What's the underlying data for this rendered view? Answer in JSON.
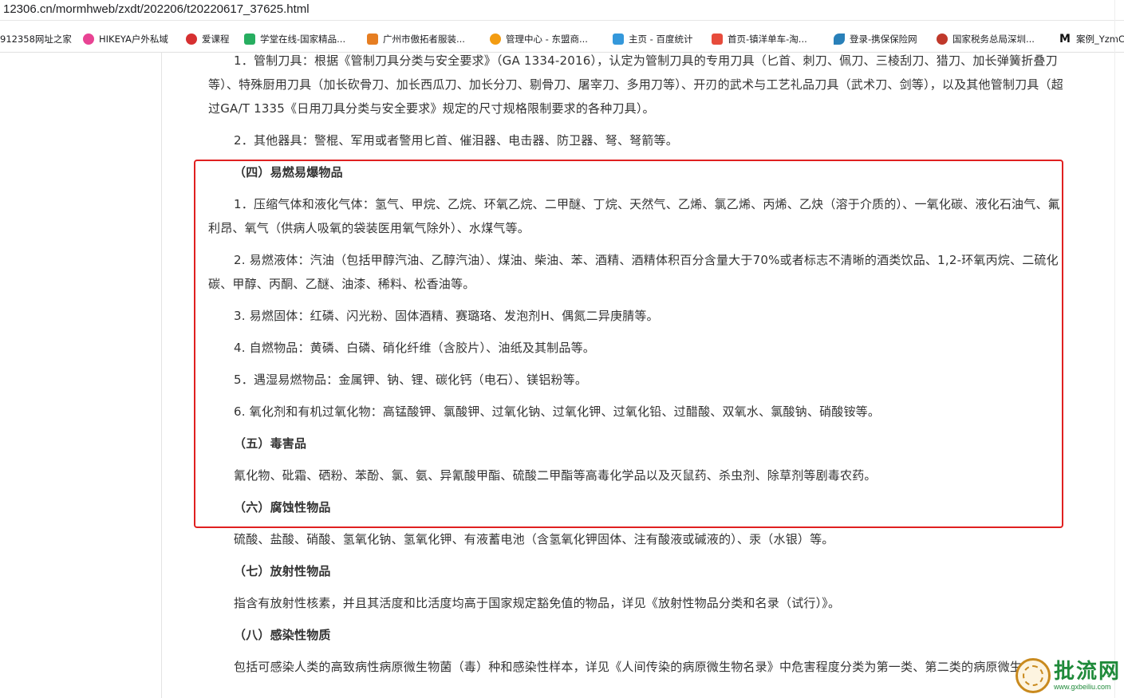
{
  "browser": {
    "url": "12306.cn/mormhweb/zxdt/202206/t20220617_37625.html",
    "bookmarks": [
      {
        "label": "912358网址之家",
        "icon": "site-icon",
        "color": ""
      },
      {
        "label": "HIKEYA户外私域",
        "icon": "hikeya-icon",
        "color": "#e84393"
      },
      {
        "label": "爱课程",
        "icon": "course-icon",
        "color": "#d63031"
      },
      {
        "label": "学堂在线-国家精品...",
        "icon": "xuetang-icon",
        "color": "#27ae60"
      },
      {
        "label": "广州市傲拓者服装...",
        "icon": "alibaba-icon",
        "color": "#e67e22"
      },
      {
        "label": "管理中心 - 东盟商...",
        "icon": "asean-icon",
        "color": "#f39c12"
      },
      {
        "label": "主页 - 百度统计",
        "icon": "baidu-stats-icon",
        "color": "#3498db"
      },
      {
        "label": "首页-镇洋单车-淘...",
        "icon": "taobao-icon",
        "color": "#e74c3c"
      },
      {
        "label": "登录-携保保险网",
        "icon": "bird-icon",
        "color": "#2980b9"
      },
      {
        "label": "国家税务总局深圳...",
        "icon": "tax-icon",
        "color": "#c0392b"
      },
      {
        "label": "案例_YzmC",
        "icon": "m-icon",
        "color": "#111111"
      }
    ]
  },
  "content": {
    "p1": "1．管制刀具：根据《管制刀具分类与安全要求》（GA 1334-2016），认定为管制刀具的专用刀具（匕首、刺刀、佩刀、三棱刮刀、猎刀、加长弹簧折叠刀等）、特殊厨用刀具（加长砍骨刀、加长西瓜刀、加长分刀、剔骨刀、屠宰刀、多用刀等）、开刃的武术与工艺礼品刀具（武术刀、剑等），以及其他管制刀具（超过GA/T 1335《日用刀具分类与安全要求》规定的尺寸规格限制要求的各种刀具）。",
    "p2": "2．其他器具：警棍、军用或者警用匕首、催泪器、电击器、防卫器、弩、弩箭等。",
    "h4": "（四）易燃易爆物品",
    "p4_1": "1．压缩气体和液化气体：氢气、甲烷、乙烷、环氧乙烷、二甲醚、丁烷、天然气、乙烯、氯乙烯、丙烯、乙炔（溶于介质的）、一氧化碳、液化石油气、氟利昂、氧气（供病人吸氧的袋装医用氧气除外）、水煤气等。",
    "p4_2": "2. 易燃液体：汽油（包括甲醇汽油、乙醇汽油）、煤油、柴油、苯、酒精、酒精体积百分含量大于70%或者标志不清晰的酒类饮品、1,2-环氧丙烷、二硫化碳、甲醇、丙酮、乙醚、油漆、稀料、松香油等。",
    "p4_3": "3. 易燃固体：红磷、闪光粉、固体酒精、赛璐珞、发泡剂H、偶氮二异庚腈等。",
    "p4_4": "4. 自燃物品：黄磷、白磷、硝化纤维（含胶片）、油纸及其制品等。",
    "p4_5": "5．遇湿易燃物品：金属钾、钠、锂、碳化钙（电石）、镁铝粉等。",
    "p4_6": "6. 氧化剂和有机过氧化物：高锰酸钾、氯酸钾、过氧化钠、过氧化钾、过氧化铅、过醋酸、双氧水、氯酸钠、硝酸铵等。",
    "h5": "（五）毒害品",
    "p5": "氰化物、砒霜、硒粉、苯酚、氯、氨、异氰酸甲酯、硫酸二甲酯等高毒化学品以及灭鼠药、杀虫剂、除草剂等剧毒农药。",
    "h6": "（六）腐蚀性物品",
    "p6": "硫酸、盐酸、硝酸、氢氧化钠、氢氧化钾、有液蓄电池（含氢氧化钾固体、注有酸液或碱液的）、汞（水银）等。",
    "h7": "（七）放射性物品",
    "p7": "指含有放射性核素，并且其活度和比活度均高于国家规定豁免值的物品，详见《放射性物品分类和名录（试行）》。",
    "h8": "（八）感染性物质",
    "p8": "包括可感染人类的高致病性病原微生物菌（毒）种和感染性样本，详见《人间传染的病原微生物名录》中危害程度分类为第一类、第二类的病原微生物。"
  },
  "watermark": {
    "title": "批流网",
    "url": "www.gxbeiliu.com"
  },
  "colors": {
    "highlight_border": "#e02020",
    "text": "#333333",
    "watermark_green": "#1f8a3a"
  }
}
